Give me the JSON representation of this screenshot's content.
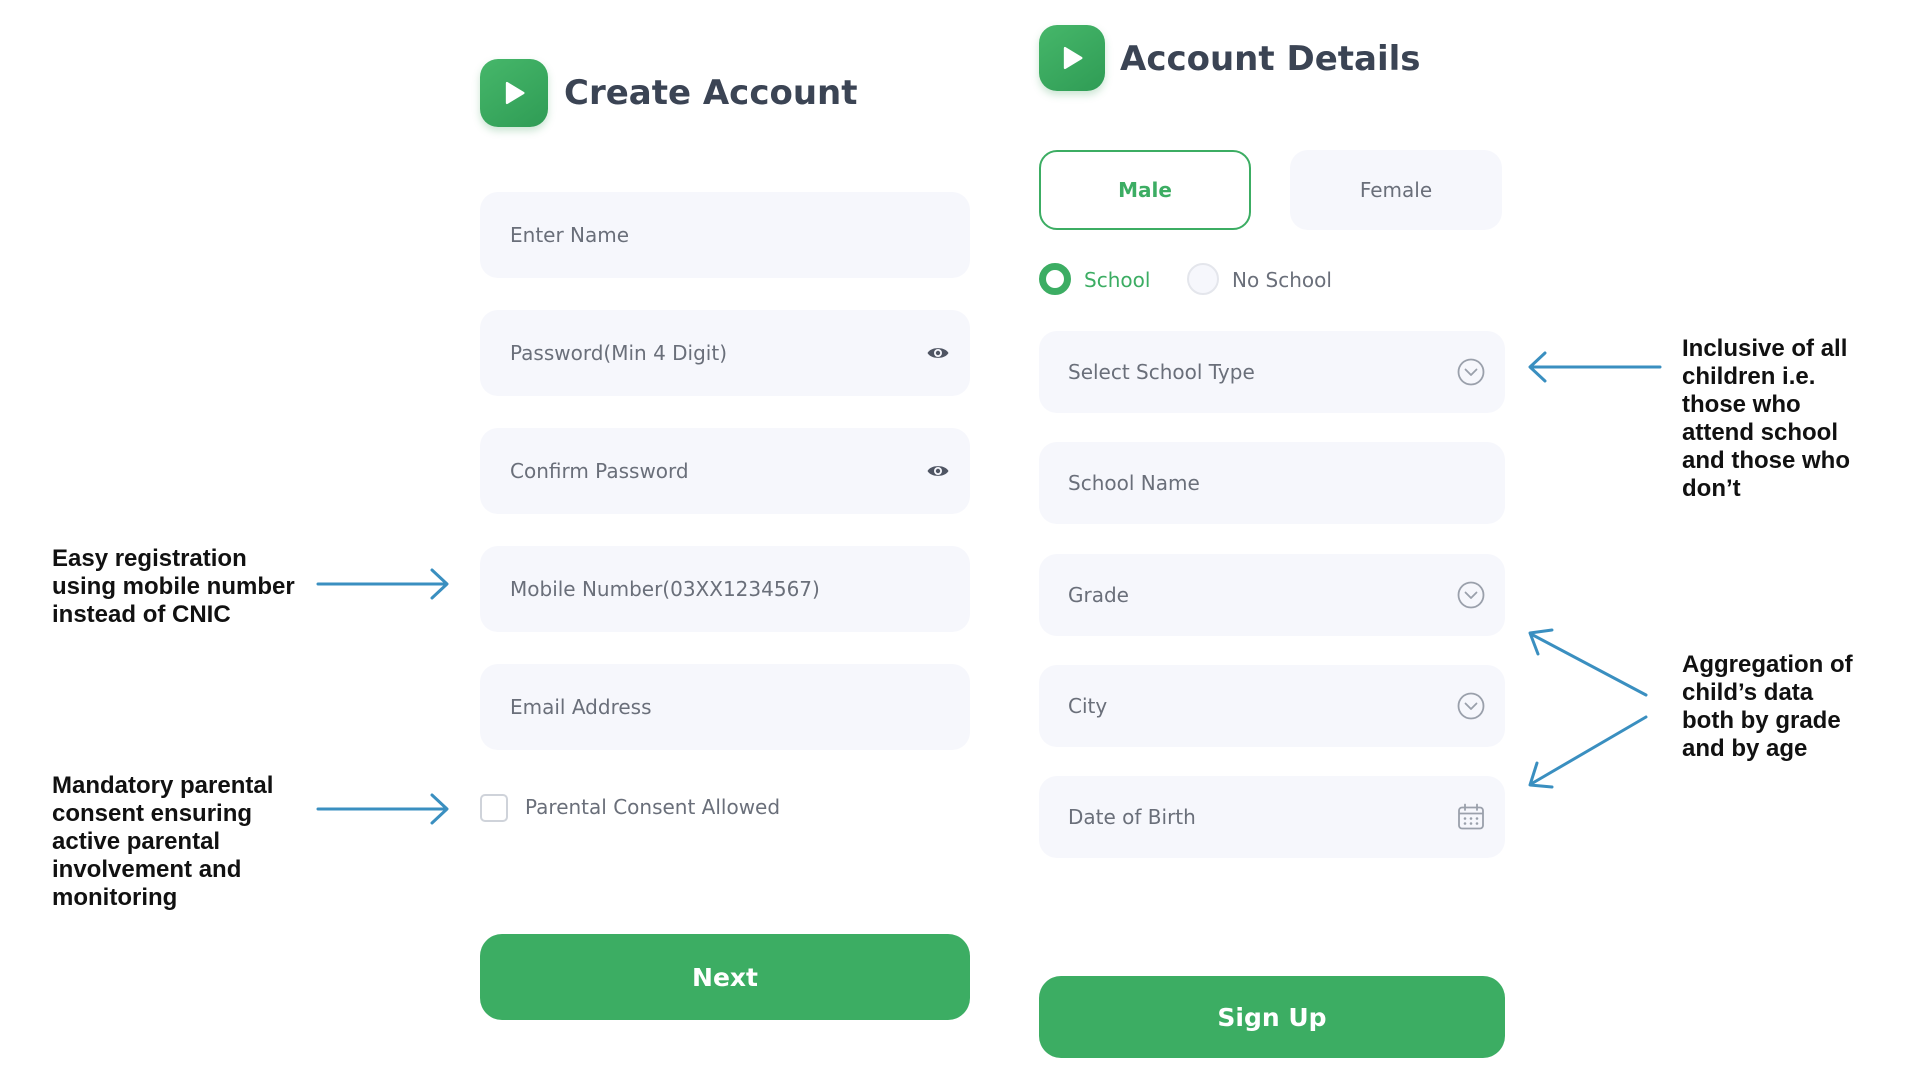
{
  "colors": {
    "brand_green": "#3cad63",
    "field_bg": "#f6f7fc",
    "title_text": "#3b4454",
    "annotation_arrow": "#3a8fc0"
  },
  "create_account": {
    "title": "Create Account",
    "logo_icon": "play-icon",
    "fields": {
      "name": "Enter Name",
      "password": "Password(Min 4 Digit)",
      "confirm_password": "Confirm Password",
      "mobile": "Mobile Number(03XX1234567)",
      "email": "Email Address"
    },
    "consent_label": "Parental Consent Allowed",
    "next_button": "Next"
  },
  "account_details": {
    "title": "Account Details",
    "logo_icon": "play-icon",
    "gender": {
      "male": "Male",
      "female": "Female",
      "selected": "Male"
    },
    "school_options": {
      "school": "School",
      "no_school": "No School",
      "selected": "School"
    },
    "fields": {
      "school_type": "Select School Type",
      "school_name": "School Name",
      "grade": "Grade",
      "city": "City",
      "dob": "Date of Birth"
    },
    "signup_button": "Sign Up"
  },
  "annotations": {
    "mobile": [
      "Easy registration",
      "using mobile number",
      "instead of CNIC"
    ],
    "consent": [
      "Mandatory parental",
      "consent ensuring",
      "active parental",
      "involvement and",
      "monitoring"
    ],
    "inclusive": [
      "Inclusive of all",
      "children i.e.",
      "those who",
      "attend school",
      "and those who",
      "don’t"
    ],
    "aggregation": [
      "Aggregation of",
      "child’s data",
      "both by grade",
      "and by age"
    ]
  }
}
